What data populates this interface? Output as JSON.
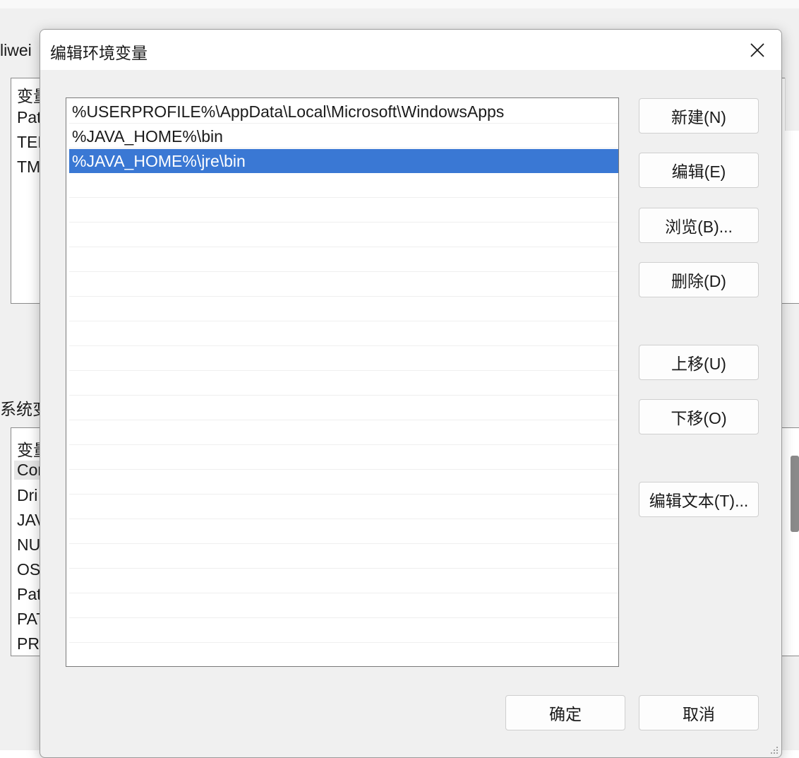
{
  "background": {
    "user_vars_label": "liwei",
    "user_list": {
      "header": "变量",
      "rows": [
        "Pat",
        "TEN",
        "TM"
      ]
    },
    "sys_vars_label": "系统变",
    "sys_list": {
      "header": "变量",
      "rows": [
        "Cor",
        "Dri",
        "JAV",
        "NU",
        "OS",
        "Pat",
        "PAT",
        "PRO"
      ]
    }
  },
  "dialog": {
    "title": "编辑环境变量",
    "close_icon": "close-icon",
    "paths": [
      "%USERPROFILE%\\AppData\\Local\\Microsoft\\WindowsApps",
      "%JAVA_HOME%\\bin",
      "%JAVA_HOME%\\jre\\bin"
    ],
    "selected_index": 2,
    "buttons": {
      "new": "新建(N)",
      "edit": "编辑(E)",
      "browse": "浏览(B)...",
      "delete": "删除(D)",
      "move_up": "上移(U)",
      "move_down": "下移(O)",
      "edit_text": "编辑文本(T)...",
      "ok": "确定",
      "cancel": "取消"
    },
    "colors": {
      "selection": "#3a78d4",
      "dialog_bg": "#f0f0f0"
    }
  }
}
